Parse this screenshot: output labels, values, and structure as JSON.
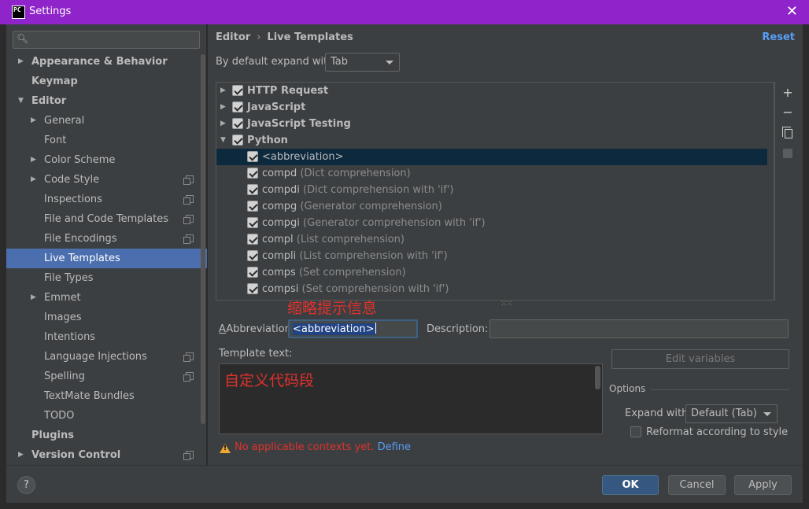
{
  "window": {
    "title": "Settings",
    "logo_text": "PC",
    "close_glyph": "✕"
  },
  "sidebar": {
    "search_placeholder": "",
    "items": [
      {
        "label": "Appearance & Behavior",
        "level": 0,
        "bold": true,
        "arrow": "▶",
        "proj": false
      },
      {
        "label": "Keymap",
        "level": 0,
        "bold": true,
        "arrow": "",
        "proj": false
      },
      {
        "label": "Editor",
        "level": 0,
        "bold": true,
        "arrow": "▼",
        "proj": false
      },
      {
        "label": "General",
        "level": 1,
        "bold": false,
        "arrow": "▶",
        "proj": false
      },
      {
        "label": "Font",
        "level": 1,
        "bold": false,
        "arrow": "",
        "proj": false
      },
      {
        "label": "Color Scheme",
        "level": 1,
        "bold": false,
        "arrow": "▶",
        "proj": false
      },
      {
        "label": "Code Style",
        "level": 1,
        "bold": false,
        "arrow": "▶",
        "proj": true
      },
      {
        "label": "Inspections",
        "level": 1,
        "bold": false,
        "arrow": "",
        "proj": true
      },
      {
        "label": "File and Code Templates",
        "level": 1,
        "bold": false,
        "arrow": "",
        "proj": true
      },
      {
        "label": "File Encodings",
        "level": 1,
        "bold": false,
        "arrow": "",
        "proj": true
      },
      {
        "label": "Live Templates",
        "level": 1,
        "bold": false,
        "arrow": "",
        "proj": false,
        "selected": true
      },
      {
        "label": "File Types",
        "level": 1,
        "bold": false,
        "arrow": "",
        "proj": false
      },
      {
        "label": "Emmet",
        "level": 1,
        "bold": false,
        "arrow": "▶",
        "proj": false
      },
      {
        "label": "Images",
        "level": 1,
        "bold": false,
        "arrow": "",
        "proj": false
      },
      {
        "label": "Intentions",
        "level": 1,
        "bold": false,
        "arrow": "",
        "proj": false
      },
      {
        "label": "Language Injections",
        "level": 1,
        "bold": false,
        "arrow": "",
        "proj": true
      },
      {
        "label": "Spelling",
        "level": 1,
        "bold": false,
        "arrow": "",
        "proj": true
      },
      {
        "label": "TextMate Bundles",
        "level": 1,
        "bold": false,
        "arrow": "",
        "proj": false
      },
      {
        "label": "TODO",
        "level": 1,
        "bold": false,
        "arrow": "",
        "proj": false
      },
      {
        "label": "Plugins",
        "level": 0,
        "bold": true,
        "arrow": "",
        "proj": false
      },
      {
        "label": "Version Control",
        "level": 0,
        "bold": true,
        "arrow": "▶",
        "proj": true
      }
    ]
  },
  "main": {
    "breadcrumb_parent": "Editor",
    "breadcrumb_sep": "›",
    "breadcrumb_current": "Live Templates",
    "reset_label": "Reset",
    "expand_label": "By default expand with",
    "expand_value": "Tab",
    "groups": [
      {
        "label": "HTTP Request",
        "expanded": false
      },
      {
        "label": "JavaScript",
        "expanded": false
      },
      {
        "label": "JavaScript Testing",
        "expanded": false
      },
      {
        "label": "Python",
        "expanded": true
      }
    ],
    "templates": [
      {
        "abbr": "<abbreviation>",
        "desc": ""
      },
      {
        "abbr": "compd",
        "desc": "(Dict comprehension)"
      },
      {
        "abbr": "compdi",
        "desc": "(Dict comprehension with 'if')"
      },
      {
        "abbr": "compg",
        "desc": "(Generator comprehension)"
      },
      {
        "abbr": "compgi",
        "desc": "(Generator comprehension with 'if')"
      },
      {
        "abbr": "compl",
        "desc": "(List comprehension)"
      },
      {
        "abbr": "compli",
        "desc": "(List comprehension with 'if')"
      },
      {
        "abbr": "comps",
        "desc": "(Set comprehension)"
      },
      {
        "abbr": "compsi",
        "desc": "(Set comprehension with 'if')"
      }
    ],
    "tools": [
      "+",
      "−"
    ],
    "annotation_abbr": "缩略提示信息",
    "abbreviation_label": "Abbreviation:",
    "abbreviation_value": "<abbreviation>",
    "description_label": "Description:",
    "description_value": "",
    "template_text_label": "Template text:",
    "template_text_value": "自定义代码段",
    "edit_variables_label": "Edit variables",
    "options_title": "Options",
    "expand_with_label": "Expand with",
    "expand_with_value": "Default (Tab)",
    "reformat_label": "Reformat according to style",
    "warning_text": "No applicable contexts yet.",
    "warning_link": "Define"
  },
  "footer": {
    "help_label": "?",
    "ok_label": "OK",
    "cancel_label": "Cancel",
    "apply_label": "Apply"
  },
  "colors": {
    "titlebar": "#8e24c9",
    "selection": "#4b6eaf",
    "accent_link": "#589df6",
    "annotation_red": "#e0312d"
  }
}
